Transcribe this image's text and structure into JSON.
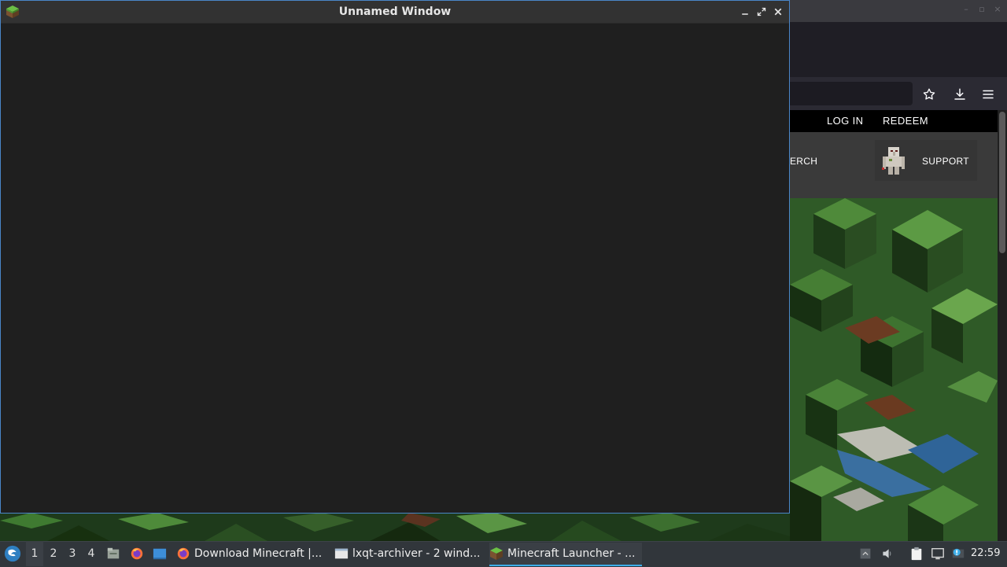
{
  "background_browser": {
    "site_nav": {
      "login": "LOG IN",
      "redeem": "REDEEM"
    },
    "menu": {
      "search_partial": "ERCH",
      "support": "SUPPORT"
    },
    "toolbar_icons": [
      "star-icon",
      "download-icon",
      "hamburger-menu-icon"
    ]
  },
  "main_window": {
    "title": "Unnamed Window",
    "controls": [
      "minimize",
      "maximize",
      "close"
    ]
  },
  "taskbar": {
    "desktops": [
      "1",
      "2",
      "3",
      "4"
    ],
    "active_desktop": "1",
    "tasks": [
      {
        "label": "Download Minecraft |...",
        "icon": "firefox-icon"
      },
      {
        "label": "lxqt-archiver - 2 wind...",
        "icon": "window-icon"
      },
      {
        "label": "Minecraft Launcher - ...",
        "icon": "minecraft-icon",
        "active": true
      }
    ],
    "clock": "22:59"
  },
  "colors": {
    "accent": "#3daee9",
    "window_border": "#4a86c8",
    "window_bg": "#1f1f1f"
  }
}
